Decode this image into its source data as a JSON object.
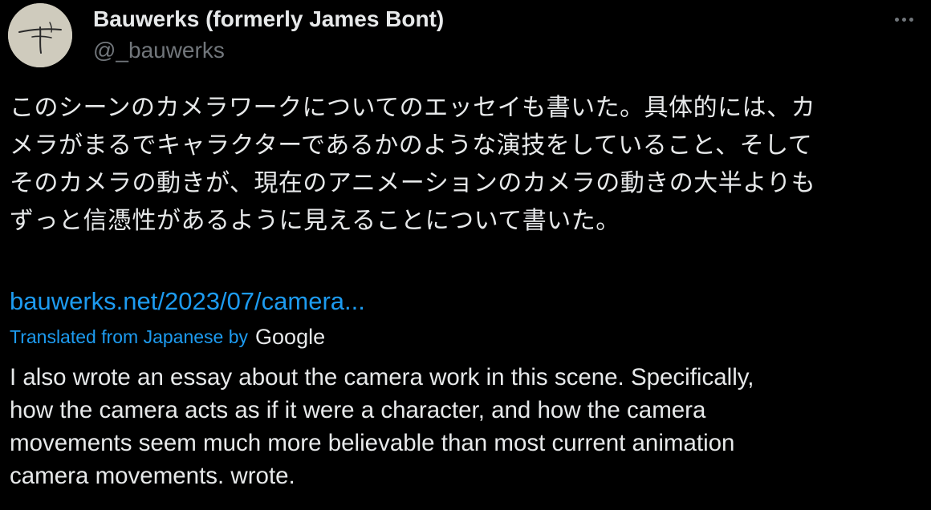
{
  "author": {
    "display_name": "Bauwerks (formerly James Bont)",
    "handle": "@_bauwerks"
  },
  "tweet": {
    "text_lines_ja": [
      "このシーンのカメラワークについてのエッセイも書いた。具体的には、カ",
      "メラがまるでキャラクターであるかのような演技をしていること、そして",
      "そのカメラの動きが、現在のアニメーションのカメラの動きの大半よりも",
      "ずっと信憑性があるように見えることについて書いた。"
    ],
    "link_text": "bauwerks.net/2023/07/camera...",
    "translated_label": "Translated from Japanese by",
    "translator_brand": "Google",
    "translation_lines": [
      "I also wrote an essay about the camera work in this scene. Specifically,",
      "how the camera acts as if it were a character, and how the camera",
      "movements seem much more believable than most current animation",
      "camera movements. wrote."
    ]
  },
  "icons": {
    "more": "more-horizontal-icon",
    "avatar": "signature-avatar"
  },
  "colors": {
    "background": "#000000",
    "text": "#e7e9ea",
    "secondary": "#71767b",
    "link": "#1d9bf0"
  }
}
